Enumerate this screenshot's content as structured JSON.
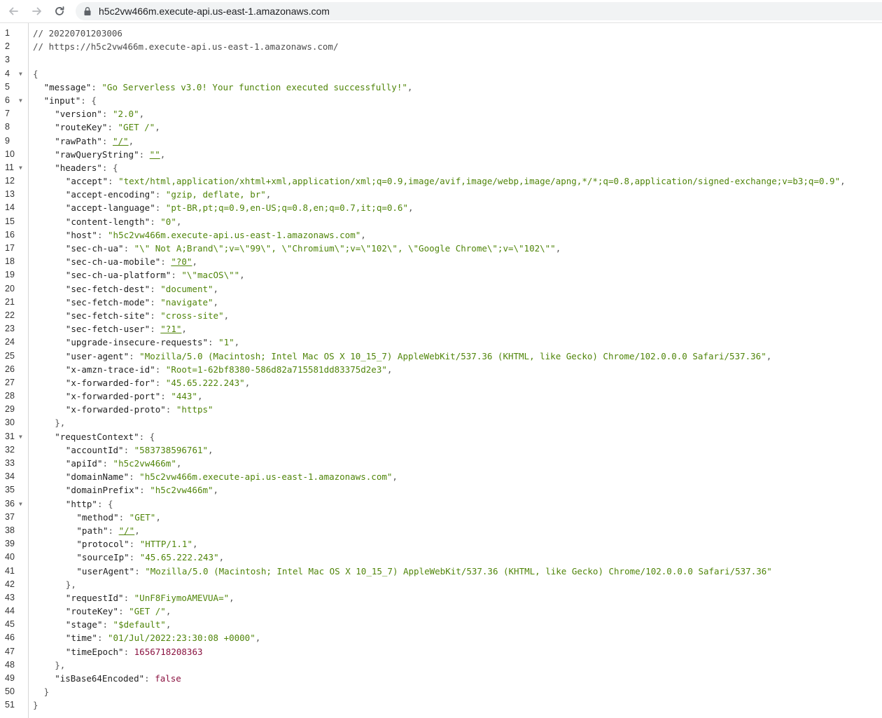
{
  "browser": {
    "url": "h5c2vw466m.execute-api.us-east-1.amazonaws.com",
    "back_icon": "arrow-left",
    "forward_icon": "arrow-right",
    "reload_icon": "reload",
    "lock_icon": "lock"
  },
  "colors": {
    "string": "#50850a",
    "number": "#8a1240",
    "key": "#222222",
    "gutter_border": "#d6d6d6"
  },
  "lines": [
    {
      "n": "1",
      "fold": false,
      "indent": 0,
      "tokens": [
        {
          "t": "c",
          "v": "// 20220701203006"
        }
      ]
    },
    {
      "n": "2",
      "fold": false,
      "indent": 0,
      "tokens": [
        {
          "t": "c",
          "v": "// https://h5c2vw466m.execute-api.us-east-1.amazonaws.com/"
        }
      ]
    },
    {
      "n": "3",
      "fold": false,
      "indent": 0,
      "tokens": []
    },
    {
      "n": "4",
      "fold": true,
      "indent": 0,
      "tokens": [
        {
          "t": "p",
          "v": "{"
        }
      ]
    },
    {
      "n": "5",
      "fold": false,
      "indent": 1,
      "tokens": [
        {
          "t": "k",
          "v": "\"message\""
        },
        {
          "t": "p",
          "v": ": "
        },
        {
          "t": "s",
          "v": "\"Go Serverless v3.0! Your function executed successfully!\""
        },
        {
          "t": "p",
          "v": ","
        }
      ]
    },
    {
      "n": "6",
      "fold": true,
      "indent": 1,
      "tokens": [
        {
          "t": "k",
          "v": "\"input\""
        },
        {
          "t": "p",
          "v": ": {"
        }
      ]
    },
    {
      "n": "7",
      "fold": false,
      "indent": 2,
      "tokens": [
        {
          "t": "k",
          "v": "\"version\""
        },
        {
          "t": "p",
          "v": ": "
        },
        {
          "t": "s",
          "v": "\"2.0\""
        },
        {
          "t": "p",
          "v": ","
        }
      ]
    },
    {
      "n": "8",
      "fold": false,
      "indent": 2,
      "tokens": [
        {
          "t": "k",
          "v": "\"routeKey\""
        },
        {
          "t": "p",
          "v": ": "
        },
        {
          "t": "s",
          "v": "\"GET /\""
        },
        {
          "t": "p",
          "v": ","
        }
      ]
    },
    {
      "n": "9",
      "fold": false,
      "indent": 2,
      "tokens": [
        {
          "t": "k",
          "v": "\"rawPath\""
        },
        {
          "t": "p",
          "v": ": "
        },
        {
          "t": "su",
          "v": "\"/\""
        },
        {
          "t": "p",
          "v": ","
        }
      ]
    },
    {
      "n": "10",
      "fold": false,
      "indent": 2,
      "tokens": [
        {
          "t": "k",
          "v": "\"rawQueryString\""
        },
        {
          "t": "p",
          "v": ": "
        },
        {
          "t": "su",
          "v": "\"\""
        },
        {
          "t": "p",
          "v": ","
        }
      ]
    },
    {
      "n": "11",
      "fold": true,
      "indent": 2,
      "tokens": [
        {
          "t": "k",
          "v": "\"headers\""
        },
        {
          "t": "p",
          "v": ": {"
        }
      ]
    },
    {
      "n": "12",
      "fold": false,
      "indent": 3,
      "tokens": [
        {
          "t": "k",
          "v": "\"accept\""
        },
        {
          "t": "p",
          "v": ": "
        },
        {
          "t": "s",
          "v": "\"text/html,application/xhtml+xml,application/xml;q=0.9,image/avif,image/webp,image/apng,*/*;q=0.8,application/signed-exchange;v=b3;q=0.9\""
        },
        {
          "t": "p",
          "v": ","
        }
      ]
    },
    {
      "n": "13",
      "fold": false,
      "indent": 3,
      "tokens": [
        {
          "t": "k",
          "v": "\"accept-encoding\""
        },
        {
          "t": "p",
          "v": ": "
        },
        {
          "t": "s",
          "v": "\"gzip, deflate, br\""
        },
        {
          "t": "p",
          "v": ","
        }
      ]
    },
    {
      "n": "14",
      "fold": false,
      "indent": 3,
      "tokens": [
        {
          "t": "k",
          "v": "\"accept-language\""
        },
        {
          "t": "p",
          "v": ": "
        },
        {
          "t": "s",
          "v": "\"pt-BR,pt;q=0.9,en-US;q=0.8,en;q=0.7,it;q=0.6\""
        },
        {
          "t": "p",
          "v": ","
        }
      ]
    },
    {
      "n": "15",
      "fold": false,
      "indent": 3,
      "tokens": [
        {
          "t": "k",
          "v": "\"content-length\""
        },
        {
          "t": "p",
          "v": ": "
        },
        {
          "t": "s",
          "v": "\"0\""
        },
        {
          "t": "p",
          "v": ","
        }
      ]
    },
    {
      "n": "16",
      "fold": false,
      "indent": 3,
      "tokens": [
        {
          "t": "k",
          "v": "\"host\""
        },
        {
          "t": "p",
          "v": ": "
        },
        {
          "t": "s",
          "v": "\"h5c2vw466m.execute-api.us-east-1.amazonaws.com\""
        },
        {
          "t": "p",
          "v": ","
        }
      ]
    },
    {
      "n": "17",
      "fold": false,
      "indent": 3,
      "tokens": [
        {
          "t": "k",
          "v": "\"sec-ch-ua\""
        },
        {
          "t": "p",
          "v": ": "
        },
        {
          "t": "s",
          "v": "\"\\\" Not A;Brand\\\";v=\\\"99\\\", \\\"Chromium\\\";v=\\\"102\\\", \\\"Google Chrome\\\";v=\\\"102\\\"\""
        },
        {
          "t": "p",
          "v": ","
        }
      ]
    },
    {
      "n": "18",
      "fold": false,
      "indent": 3,
      "tokens": [
        {
          "t": "k",
          "v": "\"sec-ch-ua-mobile\""
        },
        {
          "t": "p",
          "v": ": "
        },
        {
          "t": "su",
          "v": "\"?0\""
        },
        {
          "t": "p",
          "v": ","
        }
      ]
    },
    {
      "n": "19",
      "fold": false,
      "indent": 3,
      "tokens": [
        {
          "t": "k",
          "v": "\"sec-ch-ua-platform\""
        },
        {
          "t": "p",
          "v": ": "
        },
        {
          "t": "s",
          "v": "\"\\\"macOS\\\"\""
        },
        {
          "t": "p",
          "v": ","
        }
      ]
    },
    {
      "n": "20",
      "fold": false,
      "indent": 3,
      "tokens": [
        {
          "t": "k",
          "v": "\"sec-fetch-dest\""
        },
        {
          "t": "p",
          "v": ": "
        },
        {
          "t": "s",
          "v": "\"document\""
        },
        {
          "t": "p",
          "v": ","
        }
      ]
    },
    {
      "n": "21",
      "fold": false,
      "indent": 3,
      "tokens": [
        {
          "t": "k",
          "v": "\"sec-fetch-mode\""
        },
        {
          "t": "p",
          "v": ": "
        },
        {
          "t": "s",
          "v": "\"navigate\""
        },
        {
          "t": "p",
          "v": ","
        }
      ]
    },
    {
      "n": "22",
      "fold": false,
      "indent": 3,
      "tokens": [
        {
          "t": "k",
          "v": "\"sec-fetch-site\""
        },
        {
          "t": "p",
          "v": ": "
        },
        {
          "t": "s",
          "v": "\"cross-site\""
        },
        {
          "t": "p",
          "v": ","
        }
      ]
    },
    {
      "n": "23",
      "fold": false,
      "indent": 3,
      "tokens": [
        {
          "t": "k",
          "v": "\"sec-fetch-user\""
        },
        {
          "t": "p",
          "v": ": "
        },
        {
          "t": "su",
          "v": "\"?1\""
        },
        {
          "t": "p",
          "v": ","
        }
      ]
    },
    {
      "n": "24",
      "fold": false,
      "indent": 3,
      "tokens": [
        {
          "t": "k",
          "v": "\"upgrade-insecure-requests\""
        },
        {
          "t": "p",
          "v": ": "
        },
        {
          "t": "s",
          "v": "\"1\""
        },
        {
          "t": "p",
          "v": ","
        }
      ]
    },
    {
      "n": "25",
      "fold": false,
      "indent": 3,
      "tokens": [
        {
          "t": "k",
          "v": "\"user-agent\""
        },
        {
          "t": "p",
          "v": ": "
        },
        {
          "t": "s",
          "v": "\"Mozilla/5.0 (Macintosh; Intel Mac OS X 10_15_7) AppleWebKit/537.36 (KHTML, like Gecko) Chrome/102.0.0.0 Safari/537.36\""
        },
        {
          "t": "p",
          "v": ","
        }
      ]
    },
    {
      "n": "26",
      "fold": false,
      "indent": 3,
      "tokens": [
        {
          "t": "k",
          "v": "\"x-amzn-trace-id\""
        },
        {
          "t": "p",
          "v": ": "
        },
        {
          "t": "s",
          "v": "\"Root=1-62bf8380-586d82a715581dd83375d2e3\""
        },
        {
          "t": "p",
          "v": ","
        }
      ]
    },
    {
      "n": "27",
      "fold": false,
      "indent": 3,
      "tokens": [
        {
          "t": "k",
          "v": "\"x-forwarded-for\""
        },
        {
          "t": "p",
          "v": ": "
        },
        {
          "t": "s",
          "v": "\"45.65.222.243\""
        },
        {
          "t": "p",
          "v": ","
        }
      ]
    },
    {
      "n": "28",
      "fold": false,
      "indent": 3,
      "tokens": [
        {
          "t": "k",
          "v": "\"x-forwarded-port\""
        },
        {
          "t": "p",
          "v": ": "
        },
        {
          "t": "s",
          "v": "\"443\""
        },
        {
          "t": "p",
          "v": ","
        }
      ]
    },
    {
      "n": "29",
      "fold": false,
      "indent": 3,
      "tokens": [
        {
          "t": "k",
          "v": "\"x-forwarded-proto\""
        },
        {
          "t": "p",
          "v": ": "
        },
        {
          "t": "s",
          "v": "\"https\""
        }
      ]
    },
    {
      "n": "30",
      "fold": false,
      "indent": 2,
      "tokens": [
        {
          "t": "p",
          "v": "},"
        }
      ]
    },
    {
      "n": "31",
      "fold": true,
      "indent": 2,
      "tokens": [
        {
          "t": "k",
          "v": "\"requestContext\""
        },
        {
          "t": "p",
          "v": ": {"
        }
      ]
    },
    {
      "n": "32",
      "fold": false,
      "indent": 3,
      "tokens": [
        {
          "t": "k",
          "v": "\"accountId\""
        },
        {
          "t": "p",
          "v": ": "
        },
        {
          "t": "s",
          "v": "\"583738596761\""
        },
        {
          "t": "p",
          "v": ","
        }
      ]
    },
    {
      "n": "33",
      "fold": false,
      "indent": 3,
      "tokens": [
        {
          "t": "k",
          "v": "\"apiId\""
        },
        {
          "t": "p",
          "v": ": "
        },
        {
          "t": "s",
          "v": "\"h5c2vw466m\""
        },
        {
          "t": "p",
          "v": ","
        }
      ]
    },
    {
      "n": "34",
      "fold": false,
      "indent": 3,
      "tokens": [
        {
          "t": "k",
          "v": "\"domainName\""
        },
        {
          "t": "p",
          "v": ": "
        },
        {
          "t": "s",
          "v": "\"h5c2vw466m.execute-api.us-east-1.amazonaws.com\""
        },
        {
          "t": "p",
          "v": ","
        }
      ]
    },
    {
      "n": "35",
      "fold": false,
      "indent": 3,
      "tokens": [
        {
          "t": "k",
          "v": "\"domainPrefix\""
        },
        {
          "t": "p",
          "v": ": "
        },
        {
          "t": "s",
          "v": "\"h5c2vw466m\""
        },
        {
          "t": "p",
          "v": ","
        }
      ]
    },
    {
      "n": "36",
      "fold": true,
      "indent": 3,
      "tokens": [
        {
          "t": "k",
          "v": "\"http\""
        },
        {
          "t": "p",
          "v": ": {"
        }
      ]
    },
    {
      "n": "37",
      "fold": false,
      "indent": 4,
      "tokens": [
        {
          "t": "k",
          "v": "\"method\""
        },
        {
          "t": "p",
          "v": ": "
        },
        {
          "t": "s",
          "v": "\"GET\""
        },
        {
          "t": "p",
          "v": ","
        }
      ]
    },
    {
      "n": "38",
      "fold": false,
      "indent": 4,
      "tokens": [
        {
          "t": "k",
          "v": "\"path\""
        },
        {
          "t": "p",
          "v": ": "
        },
        {
          "t": "su",
          "v": "\"/\""
        },
        {
          "t": "p",
          "v": ","
        }
      ]
    },
    {
      "n": "39",
      "fold": false,
      "indent": 4,
      "tokens": [
        {
          "t": "k",
          "v": "\"protocol\""
        },
        {
          "t": "p",
          "v": ": "
        },
        {
          "t": "s",
          "v": "\"HTTP/1.1\""
        },
        {
          "t": "p",
          "v": ","
        }
      ]
    },
    {
      "n": "40",
      "fold": false,
      "indent": 4,
      "tokens": [
        {
          "t": "k",
          "v": "\"sourceIp\""
        },
        {
          "t": "p",
          "v": ": "
        },
        {
          "t": "s",
          "v": "\"45.65.222.243\""
        },
        {
          "t": "p",
          "v": ","
        }
      ]
    },
    {
      "n": "41",
      "fold": false,
      "indent": 4,
      "tokens": [
        {
          "t": "k",
          "v": "\"userAgent\""
        },
        {
          "t": "p",
          "v": ": "
        },
        {
          "t": "s",
          "v": "\"Mozilla/5.0 (Macintosh; Intel Mac OS X 10_15_7) AppleWebKit/537.36 (KHTML, like Gecko) Chrome/102.0.0.0 Safari/537.36\""
        }
      ]
    },
    {
      "n": "42",
      "fold": false,
      "indent": 3,
      "tokens": [
        {
          "t": "p",
          "v": "},"
        }
      ]
    },
    {
      "n": "43",
      "fold": false,
      "indent": 3,
      "tokens": [
        {
          "t": "k",
          "v": "\"requestId\""
        },
        {
          "t": "p",
          "v": ": "
        },
        {
          "t": "s",
          "v": "\"UnF8FiymoAMEVUA=\""
        },
        {
          "t": "p",
          "v": ","
        }
      ]
    },
    {
      "n": "44",
      "fold": false,
      "indent": 3,
      "tokens": [
        {
          "t": "k",
          "v": "\"routeKey\""
        },
        {
          "t": "p",
          "v": ": "
        },
        {
          "t": "s",
          "v": "\"GET /\""
        },
        {
          "t": "p",
          "v": ","
        }
      ]
    },
    {
      "n": "45",
      "fold": false,
      "indent": 3,
      "tokens": [
        {
          "t": "k",
          "v": "\"stage\""
        },
        {
          "t": "p",
          "v": ": "
        },
        {
          "t": "s",
          "v": "\"$default\""
        },
        {
          "t": "p",
          "v": ","
        }
      ]
    },
    {
      "n": "46",
      "fold": false,
      "indent": 3,
      "tokens": [
        {
          "t": "k",
          "v": "\"time\""
        },
        {
          "t": "p",
          "v": ": "
        },
        {
          "t": "s",
          "v": "\"01/Jul/2022:23:30:08 +0000\""
        },
        {
          "t": "p",
          "v": ","
        }
      ]
    },
    {
      "n": "47",
      "fold": false,
      "indent": 3,
      "tokens": [
        {
          "t": "k",
          "v": "\"timeEpoch\""
        },
        {
          "t": "p",
          "v": ": "
        },
        {
          "t": "n",
          "v": "1656718208363"
        }
      ]
    },
    {
      "n": "48",
      "fold": false,
      "indent": 2,
      "tokens": [
        {
          "t": "p",
          "v": "},"
        }
      ]
    },
    {
      "n": "49",
      "fold": false,
      "indent": 2,
      "tokens": [
        {
          "t": "k",
          "v": "\"isBase64Encoded\""
        },
        {
          "t": "p",
          "v": ": "
        },
        {
          "t": "b",
          "v": "false"
        }
      ]
    },
    {
      "n": "50",
      "fold": false,
      "indent": 1,
      "tokens": [
        {
          "t": "p",
          "v": "}"
        }
      ]
    },
    {
      "n": "51",
      "fold": false,
      "indent": 0,
      "tokens": [
        {
          "t": "p",
          "v": "}"
        }
      ]
    }
  ]
}
